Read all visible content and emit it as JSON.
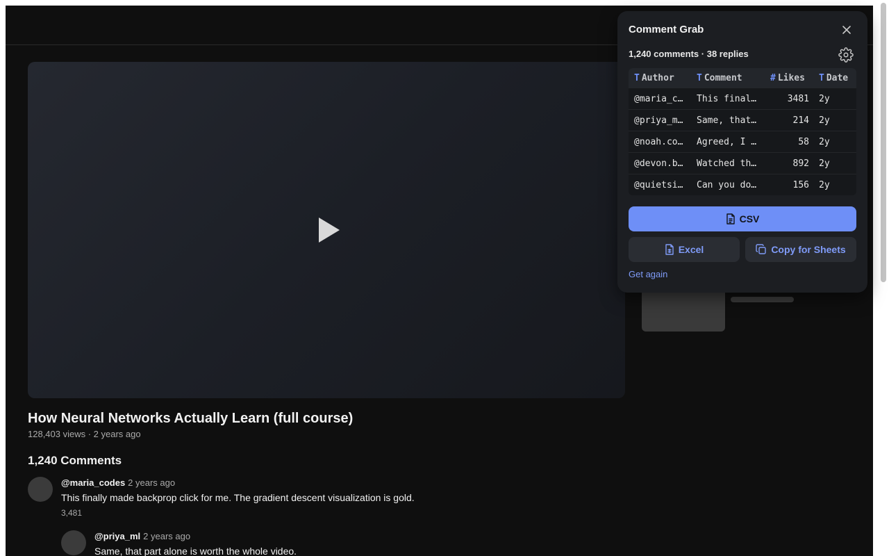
{
  "video": {
    "title": "How Neural Networks Actually Learn (full course)",
    "meta": "128,403 views · 2 years ago"
  },
  "comments": {
    "heading": "1,240 Comments",
    "items": [
      {
        "author": "@maria_codes",
        "time": "2 years ago",
        "text": "This finally made backprop click for me. The gradient descent visualization is gold.",
        "likes": "3,481"
      },
      {
        "author": "@priya_ml",
        "time": "2 years ago",
        "text": "Same, that part alone is worth the whole video."
      }
    ]
  },
  "panel": {
    "title": "Comment Grab",
    "count": "1,240 comments · 38 replies",
    "columns": [
      {
        "type": "T",
        "label": "Author"
      },
      {
        "type": "T",
        "label": "Comment"
      },
      {
        "type": "#",
        "label": "Likes"
      },
      {
        "type": "T",
        "label": "Date"
      }
    ],
    "rows": [
      {
        "author": "@maria_c…",
        "comment": "This final…",
        "likes": "3481",
        "date": "2y"
      },
      {
        "author": "@priya_m…",
        "comment": "Same, that…",
        "likes": "214",
        "date": "2y"
      },
      {
        "author": "@noah.co…",
        "comment": "Agreed, I …",
        "likes": "58",
        "date": "2y"
      },
      {
        "author": "@devon.b…",
        "comment": "Watched th…",
        "likes": "892",
        "date": "2y"
      },
      {
        "author": "@quietsi…",
        "comment": "Can you do…",
        "likes": "156",
        "date": "2y"
      }
    ],
    "csv_label": "CSV",
    "excel_label": "Excel",
    "copy_label": "Copy for Sheets",
    "get_again_label": "Get again",
    "accent_color": "#6e8ff7"
  }
}
